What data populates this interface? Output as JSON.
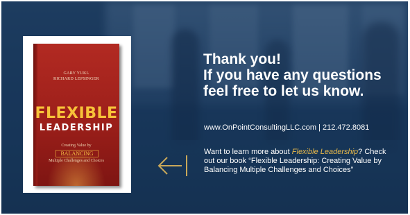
{
  "book": {
    "author1": "GARY YUKL",
    "author2": "RICHARD LEPSINGER",
    "title_line1": "FLEXIBLE",
    "title_line2": "LEADERSHIP",
    "sub1": "Creating Value by",
    "balancing": "BALANCING",
    "sub2": "Multiple Challenges and Choices"
  },
  "heading": {
    "line1": "Thank you!",
    "line2": "If you have any questions",
    "line3": "feel free to let us know."
  },
  "contact": {
    "website": "www.OnPointConsultingLLC.com",
    "separator": "|",
    "phone": "212.472.8081"
  },
  "more": {
    "prefix": "Want to learn more about ",
    "book_title": "Flexible Leadership",
    "suffix": "? Check out our book “Flexible Leadership: Creating Value by Balancing Multiple Challenges and Choices”"
  },
  "icons": {
    "arrow": "arrow-left-to-bar-icon"
  },
  "colors": {
    "background": "#1c3a5e",
    "accent": "#e8b84a",
    "book_red": "#a3231d",
    "book_title": "#f7c239"
  }
}
